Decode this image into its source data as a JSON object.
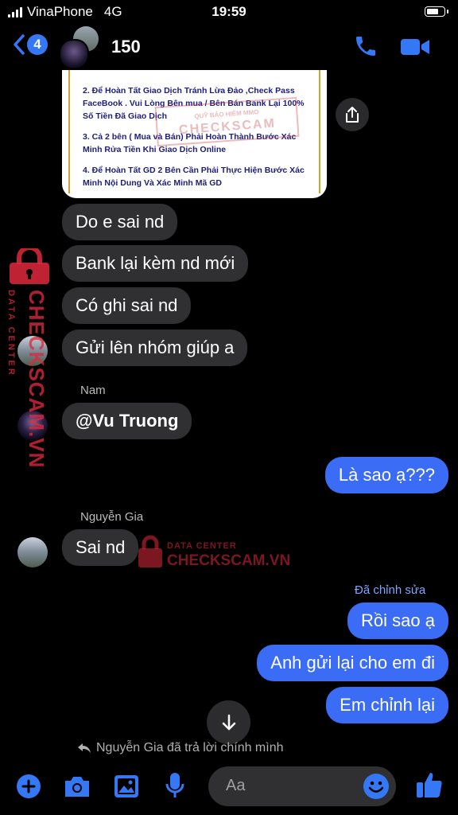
{
  "status_bar": {
    "carrier": "VinaPhone",
    "network": "4G",
    "time": "19:59",
    "battery_level": 0.75
  },
  "header": {
    "unread_count": "4",
    "title": "150",
    "call_icon": "phone-icon",
    "video_icon": "video-camera-icon"
  },
  "screenshot_card": {
    "lines": [
      "2. Để Hoàn Tất Giao Dịch Tránh Lừa Đảo ,Check Pass FaceBook . Vui Lòng Bên mua / Bên Bán Bank Lại 100% Số Tiền Đã Giao Dịch",
      "3. Cả 2 bên ( Mua và Bán) Phải Hoàn Thành Bước Xác Minh Rửa Tiền Khi Giao Dịch Online",
      "4. Để Hoàn Tất GD 2 Bên Cần Phải Thực Hiện Bước Xác Minh Nội Dung Và Xác Minh Mã GD"
    ],
    "watermark_line1": "QUỸ BẢO HIỂM MMO",
    "watermark_line2": "CHECKSCAM"
  },
  "messages": {
    "m1": "Do e sai nd",
    "m2": "Bank lại kèm nd mới",
    "m3": "Có ghi sai nd",
    "m4": "Gửi lên nhóm giúp a",
    "sender_nam": "Nam",
    "m5": "@Vu Truong",
    "m6": "Là sao ạ???",
    "sender_gia": "Nguyễn Gia",
    "m7": "Sai nd",
    "edited_label": "Đã chỉnh sửa",
    "m8": "Rồi sao ạ",
    "m9": "Anh gửi lại cho em đi",
    "m10": "Em chỉnh lại"
  },
  "reply_note": "Nguyễn Gia đã trả lời chính mình",
  "watermark": {
    "side_big": "CHECKSCAM.VN",
    "side_small": "DATA CENTER",
    "mid_small": "DATA CENTER",
    "mid_big": "CHECKSCAM.VN"
  },
  "composer": {
    "placeholder": "Aa"
  },
  "colors": {
    "accent": "#3478f6",
    "outgoing_bubble": "#3a6cf5",
    "incoming_bubble": "#303032",
    "watermark": "#e1283c"
  }
}
